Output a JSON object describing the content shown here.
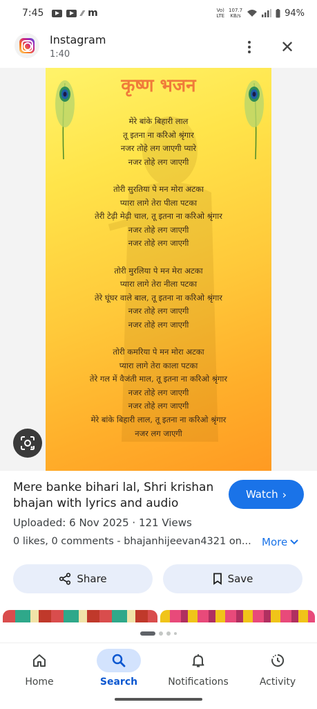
{
  "status_bar": {
    "time": "7:45",
    "left_icons": [
      "youtube-icon",
      "youtube-icon",
      "slash-icon",
      "m-icon"
    ],
    "volte": "Vo)\nLTE",
    "speed_value": "107.7",
    "speed_unit": "KB/s",
    "battery": "94%"
  },
  "header": {
    "app_name": "Instagram",
    "duration": "1:40"
  },
  "bhajan": {
    "title": "कृष्ण भजन",
    "stanzas": [
      [
        "मेरे बांके बिहारी लाल",
        "तू इतना ना करिओ श्रृंगार",
        "नजर तोहे लग जाएगी प्यारे",
        "नजर तोहे लग जाएगी"
      ],
      [
        "तोरी सुरतिया पे मन मोरा अटका",
        "प्यारा लागे तेरा पीला पटका",
        "तेरी टेढ़ी मेढ़ी चाल, तू इतना ना करिओ श्रृंगार",
        "नजर तोहे लग जाएगी",
        "नजर तोहे लग जाएगी"
      ],
      [
        "तोरी मुरलिया पे मन मेरा अटका",
        "प्यारा लागे तेरा नीला पटका",
        "तेरे घूंघर वाले बाल, तू इतना ना करिओ श्रृंगार",
        "नजर तोहे लग जाएगी",
        "नजर तोहे लग जाएगी"
      ],
      [
        "तोरी कमरिया पे मन मोरा अटका",
        "प्यारा लागे तेरा काला पटका",
        "तेरे गल में वैजंती माल, तू इतना ना करिओ श्रृंगार",
        "नजर तोहे लग जाएगी",
        "नजर तोहे लग जाएगी",
        "मेरे बांके बिहारी लाल, तू इतना ना करिओ श्रृंगार",
        "नजर लग जाएगी"
      ]
    ]
  },
  "video": {
    "title": "Mere banke bihari lal, Shri krishan bhajan with lyrics and audio",
    "watch_label": "Watch",
    "meta": "Uploaded: 6 Nov 2025 · 121 Views",
    "description": "0 likes, 0 comments - bhajanhijeevan4321 on...",
    "more_label": "More"
  },
  "actions": {
    "share_label": "Share",
    "save_label": "Save"
  },
  "bottom_nav": {
    "items": [
      {
        "label": "Home",
        "icon": "home-icon"
      },
      {
        "label": "Search",
        "icon": "search-icon",
        "active": true
      },
      {
        "label": "Notifications",
        "icon": "bell-icon"
      },
      {
        "label": "Activity",
        "icon": "activity-icon"
      }
    ]
  },
  "colors": {
    "accent": "#1a73e8",
    "active_nav": "#0b57d0",
    "title_orange": "#f07a3a"
  }
}
